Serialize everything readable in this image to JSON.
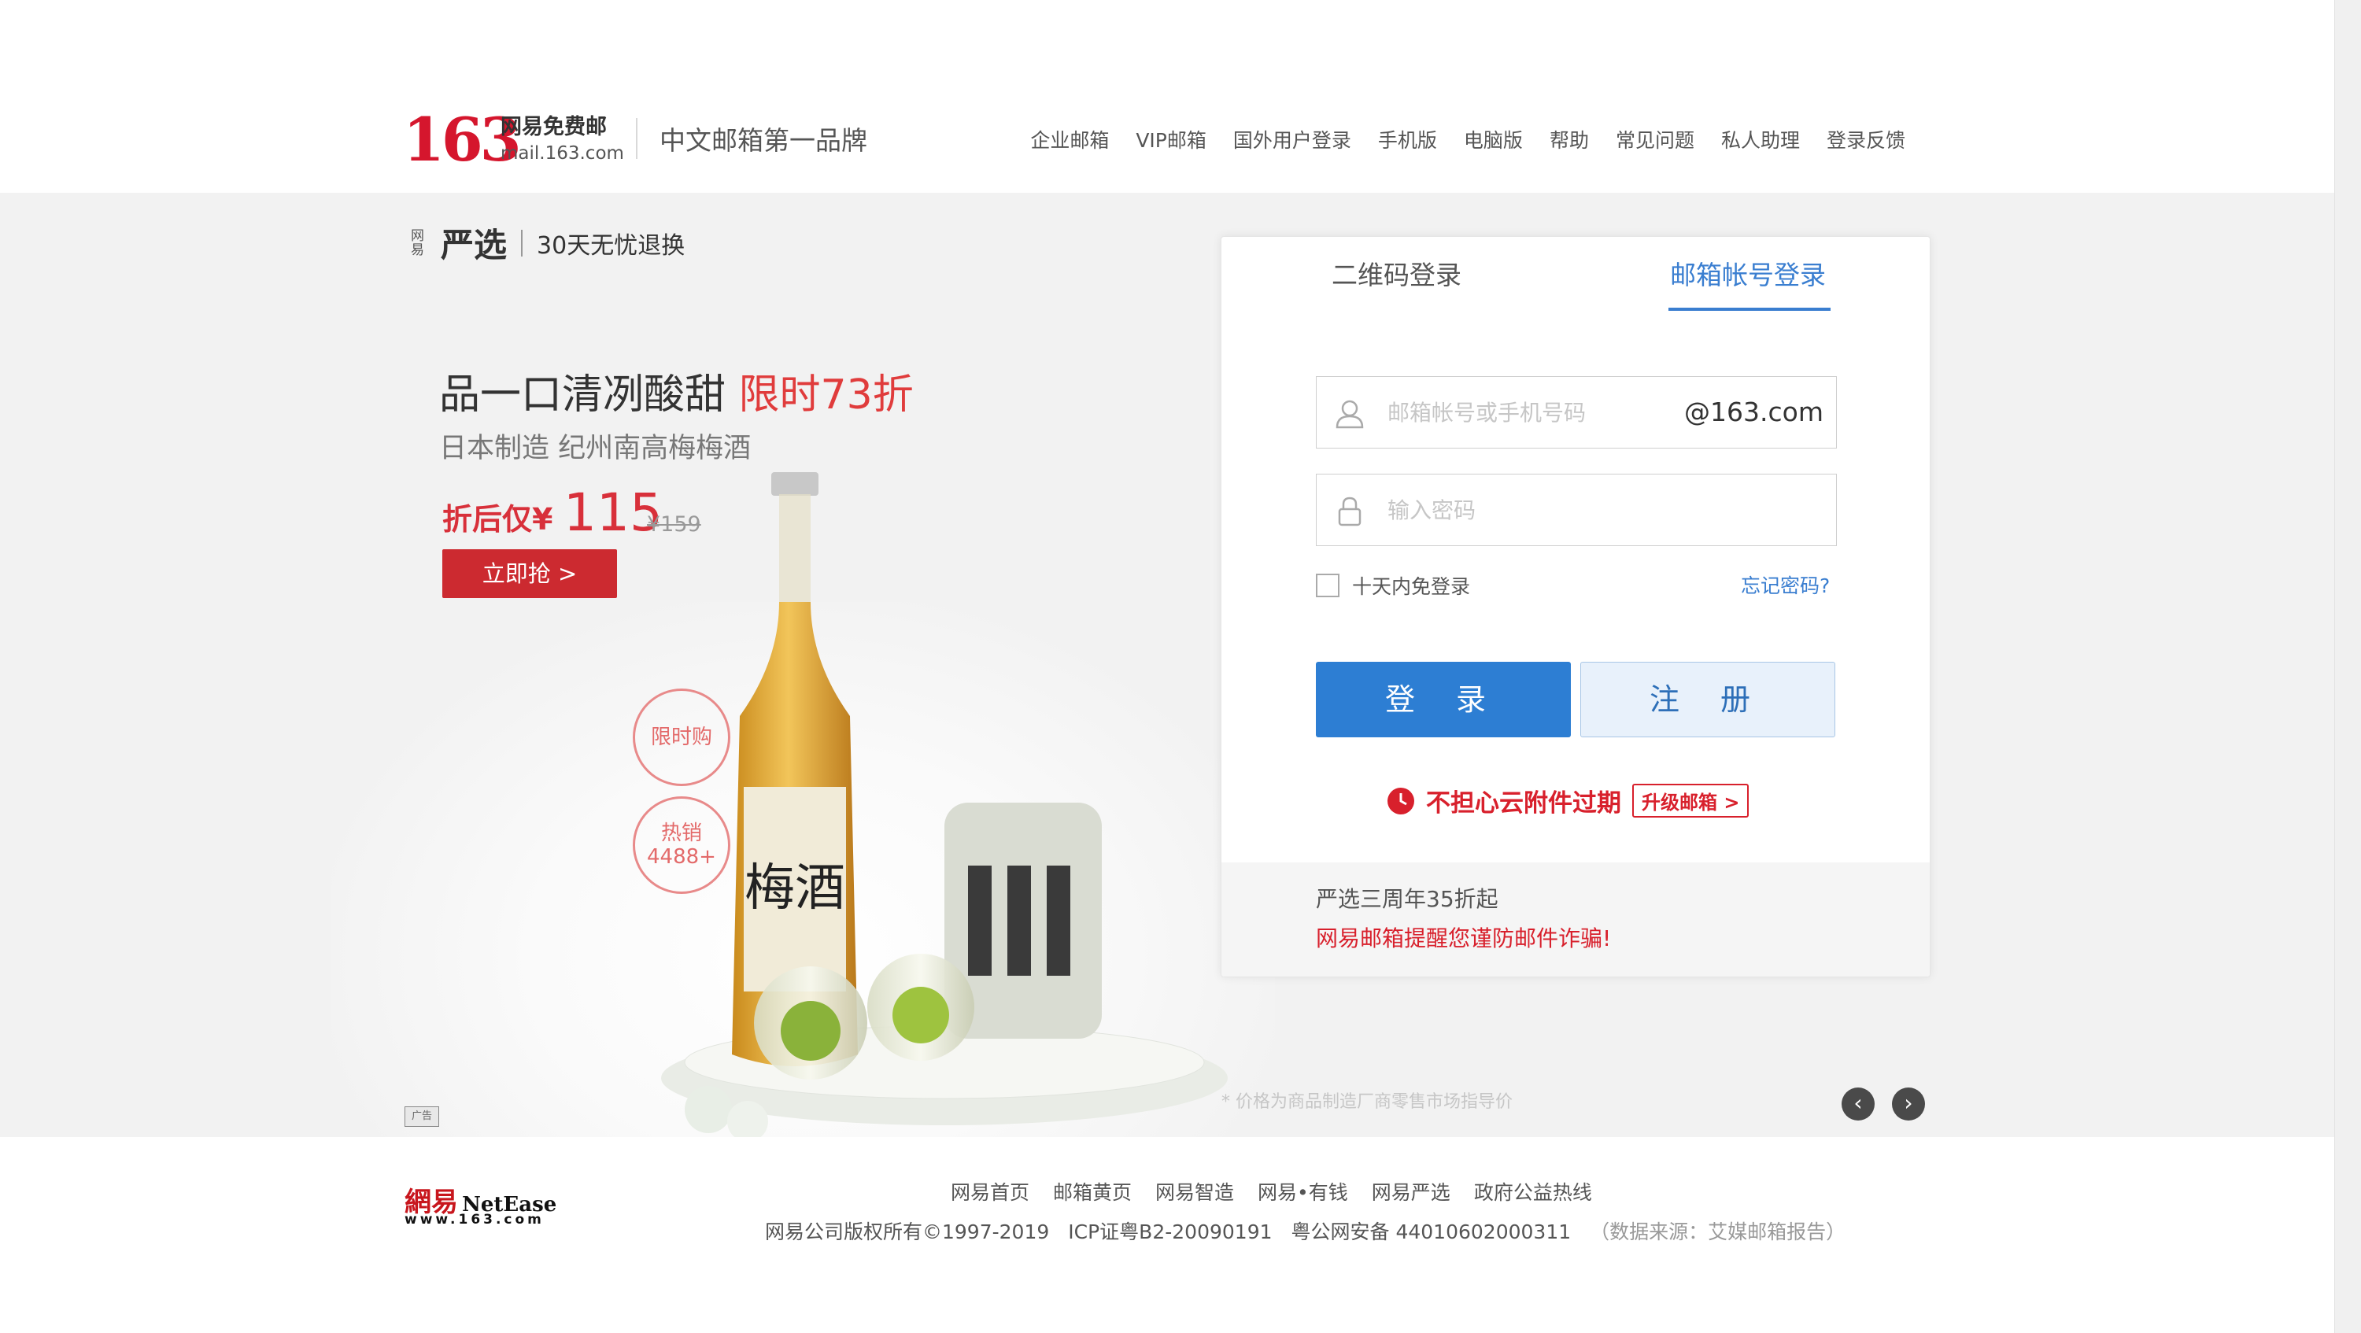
{
  "header": {
    "logo_number": "163",
    "logo_cn": "网易免费邮",
    "logo_domain": "mail.163.com",
    "slogan": "中文邮箱第一品牌",
    "nav": [
      "企业邮箱",
      "VIP邮箱",
      "国外用户登录",
      "手机版",
      "电脑版",
      "帮助",
      "常见问题",
      "私人助理",
      "登录反馈"
    ]
  },
  "banner": {
    "brand_small": "网易",
    "brand_big": "严选",
    "brand_slogan": "30天无忧退换",
    "title_main": "品一口清冽酸甜",
    "title_highlight": "限时73折",
    "subtitle": "日本制造 纪州南高梅梅酒",
    "price_label": "折后仅¥",
    "price": "115",
    "old_price": "¥159",
    "buy_button": "立即抢 >",
    "badge_1": "限时购",
    "badge_2_line1": "热销",
    "badge_2_line2": "4488+",
    "bottle_label": "梅酒",
    "ad_mark": "广告",
    "price_note": "* 价格为商品制造厂商零售市场指导价",
    "prev": "‹",
    "next": "›"
  },
  "login": {
    "tab_qr": "二维码登录",
    "tab_account": "邮箱帐号登录",
    "username_placeholder": "邮箱帐号或手机号码",
    "domain_suffix": "@163.com",
    "password_placeholder": "输入密码",
    "remember_label": "十天内免登录",
    "forgot_link": "忘记密码?",
    "login_button": "登 录",
    "register_button": "注 册",
    "promo_text": "不担心云附件过期",
    "upgrade_button": "升级邮箱 >",
    "footer_line1": "严选三周年35折起",
    "footer_line2": "网易邮箱提醒您谨防邮件诈骗!"
  },
  "footer": {
    "logo_cn": "網易",
    "logo_en": "NetEase",
    "logo_url": "www.163.com",
    "links": [
      "网易首页",
      "邮箱黄页",
      "网易智造",
      "网易•有钱",
      "网易严选",
      "政府公益热线"
    ],
    "copyright": "网易公司版权所有©1997-2019",
    "icp": "ICP证粤B2-20090191",
    "police": "粤公网安备 44010602000311",
    "source": "（数据来源：艾媒邮箱报告）"
  },
  "colors": {
    "brand_red": "#d5162d",
    "accent_blue": "#2d7ed3",
    "banner_bg": "#f2f2f2"
  }
}
